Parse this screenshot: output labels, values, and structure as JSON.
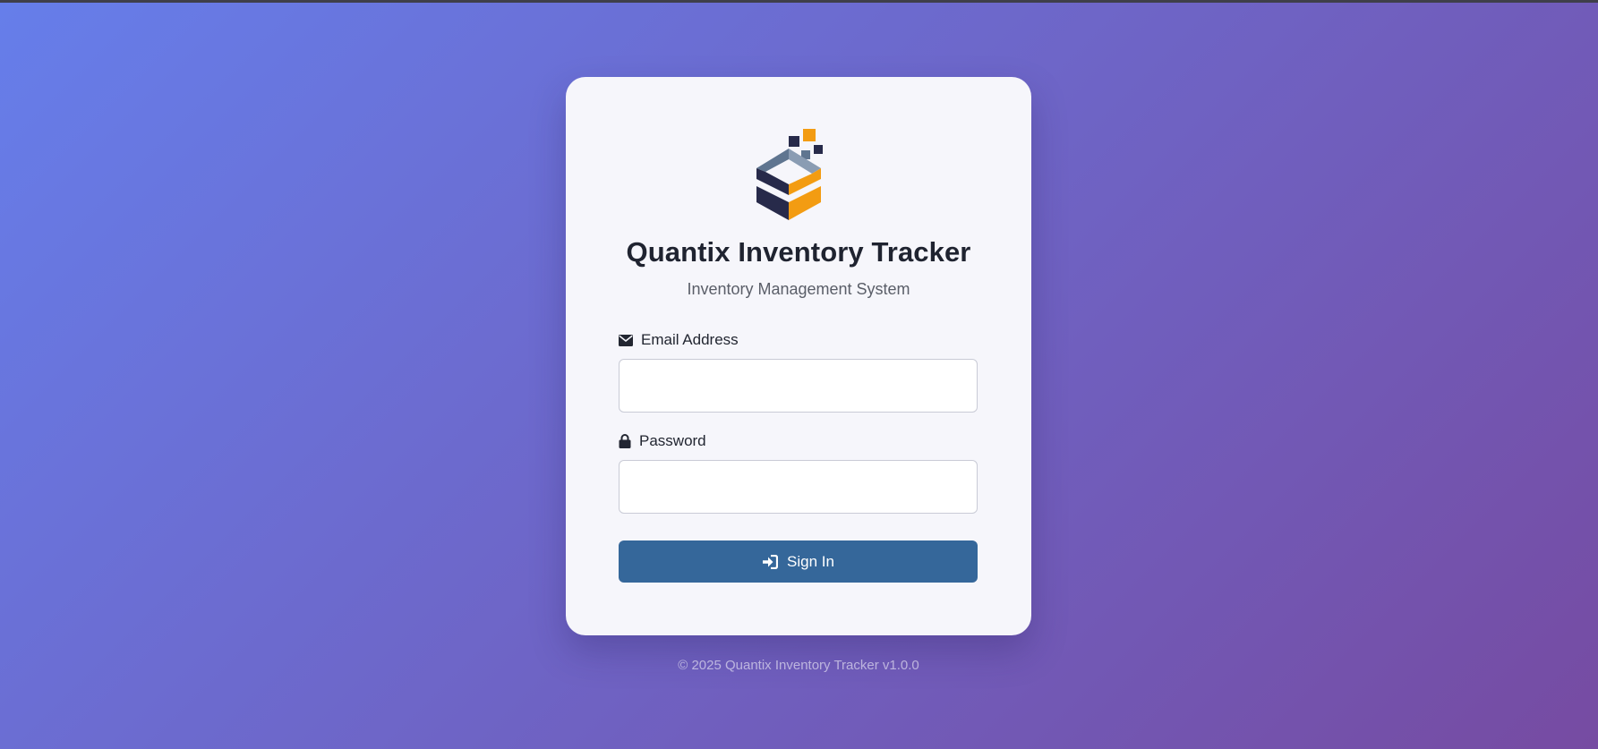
{
  "app": {
    "title": "Quantix Inventory Tracker",
    "subtitle": "Inventory Management System",
    "logo_icon": "stacked-cube-logo"
  },
  "form": {
    "email": {
      "label": "Email Address",
      "icon": "envelope-icon",
      "value": "",
      "placeholder": ""
    },
    "password": {
      "label": "Password",
      "icon": "lock-icon",
      "value": "",
      "placeholder": ""
    },
    "submit": {
      "label": "Sign In",
      "icon": "sign-in-icon"
    }
  },
  "footer": {
    "text": "© 2025 Quantix Inventory Tracker v1.0.0"
  },
  "colors": {
    "background_start": "#667eea",
    "background_end": "#764ba2",
    "card": "#f6f6fb",
    "primary_button": "#35679a",
    "logo_navy": "#272a4a",
    "logo_orange": "#f39c12",
    "logo_slate": "#5f7590"
  }
}
